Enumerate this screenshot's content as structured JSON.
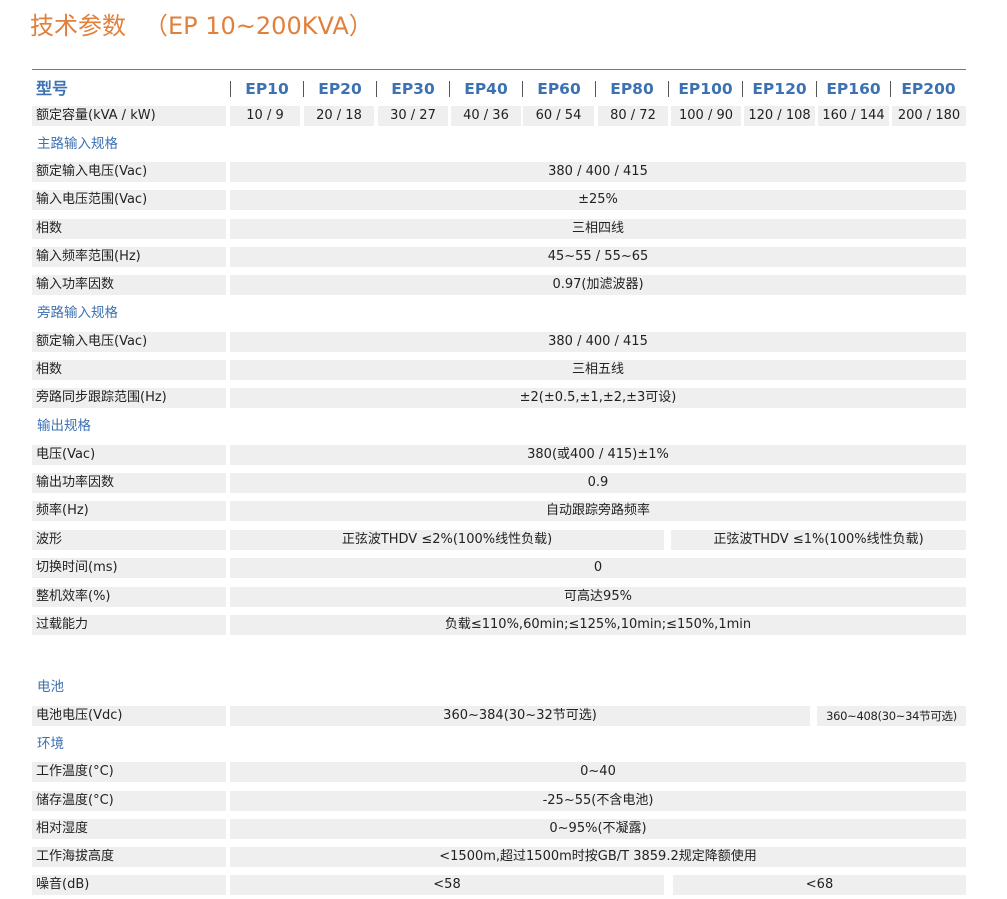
{
  "title": {
    "main": "技术参数",
    "sub": "（EP 10~200KVA）"
  },
  "header": {
    "label": "型号",
    "models": [
      "EP10",
      "EP20",
      "EP30",
      "EP40",
      "EP60",
      "EP80",
      "EP100",
      "EP120",
      "EP160",
      "EP200"
    ]
  },
  "capacity": {
    "label": "额定容量(kVA / kW)",
    "values": [
      "10 / 9",
      "20 / 18",
      "30 / 27",
      "40 / 36",
      "60 / 54",
      "80 / 72",
      "100 / 90",
      "120 / 108",
      "160 / 144",
      "200 / 180"
    ]
  },
  "sections": {
    "main_input": "主路输入规格",
    "bypass_input": "旁路输入规格",
    "output": "输出规格",
    "battery": "电池",
    "environment": "环境"
  },
  "main_input": [
    {
      "label": "额定输入电压(Vac)",
      "value": "380 / 400 / 415"
    },
    {
      "label": "输入电压范围(Vac)",
      "value": "±25%"
    },
    {
      "label": "相数",
      "value": "三相四线"
    },
    {
      "label": "输入频率范围(Hz)",
      "value": "45~55 / 55~65"
    },
    {
      "label": "输入功率因数",
      "value": "0.97(加滤波器)"
    }
  ],
  "bypass_input": [
    {
      "label": "额定输入电压(Vac)",
      "value": "380 / 400 / 415"
    },
    {
      "label": "相数",
      "value": "三相五线"
    },
    {
      "label": "旁路同步跟踪范围(Hz)",
      "value": "±2(±0.5,±1,±2,±3可设)"
    }
  ],
  "output": {
    "voltage": {
      "label": "电压(Vac)",
      "value": "380(或400 / 415)±1%"
    },
    "power_factor": {
      "label": "输出功率因数",
      "value": "0.9"
    },
    "frequency": {
      "label": "频率(Hz)",
      "value": "自动跟踪旁路频率"
    },
    "waveform": {
      "label": "波形",
      "value_a": "正弦波THDV ≤2%(100%线性负载)",
      "value_b": "正弦波THDV ≤1%(100%线性负载)"
    },
    "transfer_time": {
      "label": "切换时间(ms)",
      "value": "0"
    },
    "efficiency": {
      "label": "整机效率(%)",
      "value": "可高达95%"
    },
    "overload": {
      "label": "过载能力",
      "value": "负载≤110%,60min;≤125%,10min;≤150%,1min"
    }
  },
  "battery": {
    "voltage": {
      "label": "电池电压(Vdc)",
      "value_a": "360~384(30~32节可选)",
      "value_b": "360~408(30~34节可选)"
    }
  },
  "environment": {
    "op_temp": {
      "label": "工作温度(°C)",
      "value": "0~40"
    },
    "storage_temp": {
      "label": "储存温度(°C)",
      "value": "-25~55(不含电池)"
    },
    "humidity": {
      "label": "相对湿度",
      "value": "0~95%(不凝露)"
    },
    "altitude": {
      "label": "工作海拔高度",
      "value": "<1500m,超过1500m时按GB/T 3859.2规定降额使用"
    },
    "noise": {
      "label": "噪音(dB)",
      "value_a": "<58",
      "value_b": "<68"
    }
  }
}
